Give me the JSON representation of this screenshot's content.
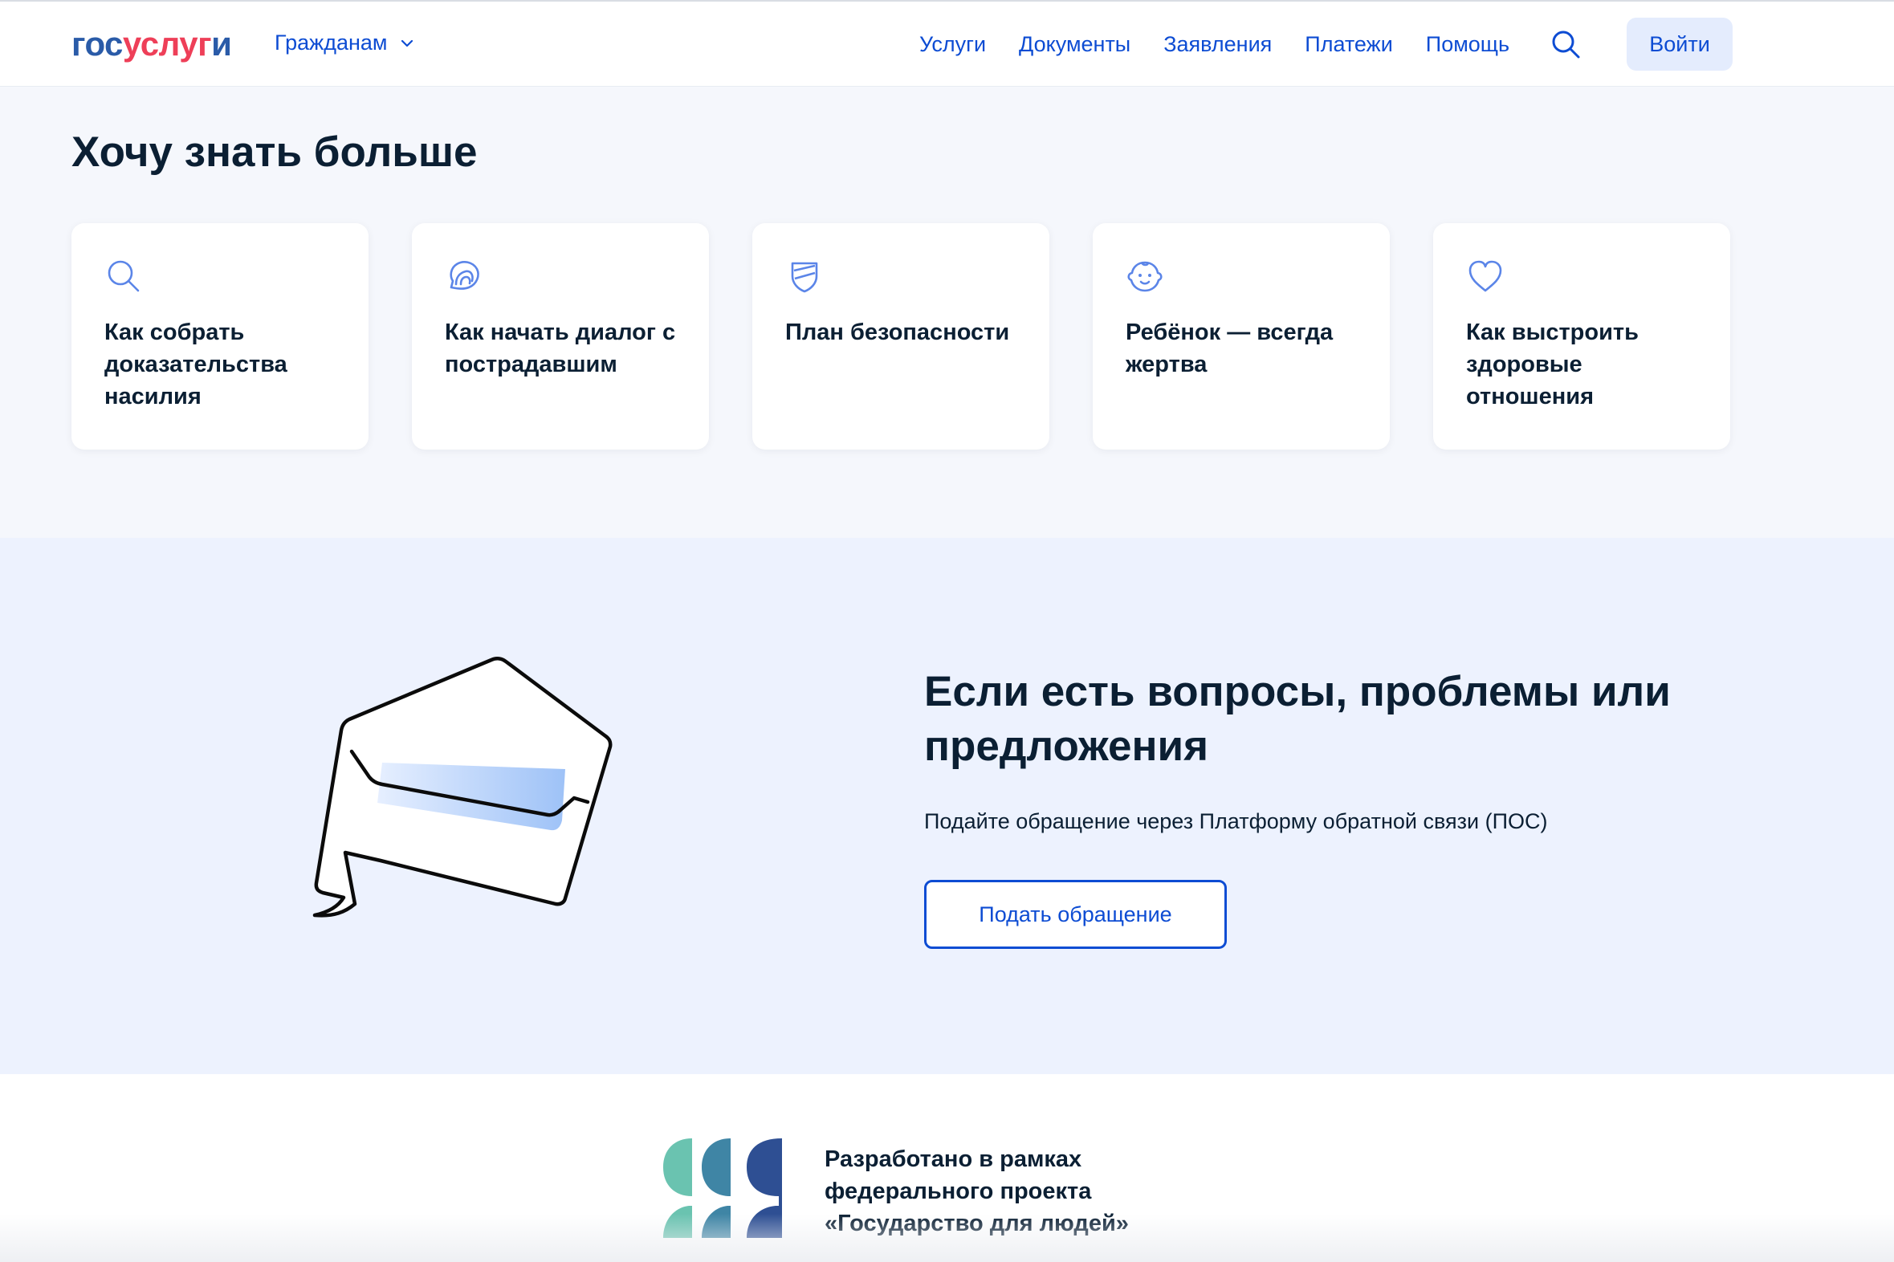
{
  "header": {
    "logo": {
      "part1": "гос",
      "part2": "услуг",
      "part3": "и"
    },
    "audience_label": "Гражданам",
    "nav": [
      "Услуги",
      "Документы",
      "Заявления",
      "Платежи",
      "Помощь"
    ],
    "login_label": "Войти"
  },
  "more": {
    "title": "Хочу знать больше",
    "cards": [
      {
        "icon": "search-icon",
        "text": "Как собрать доказательства насилия"
      },
      {
        "icon": "dialog-icon",
        "text": "Как начать диалог с пострадавшим"
      },
      {
        "icon": "shield-icon",
        "text": "План безопасности"
      },
      {
        "icon": "child-face-icon",
        "text": "Ребёнок — всегда жертва"
      },
      {
        "icon": "heart-icon",
        "text": "Как выстроить здоровые отношения"
      }
    ]
  },
  "feedback": {
    "title": "Если есть вопросы, проблемы или предложения",
    "subtitle": "Подайте обращение через Платформу обратной связи (ПОС)",
    "button_label": "Подать обращение"
  },
  "footer": {
    "project_lines": [
      "Разработано в рамках",
      "федерального проекта",
      "«Государство для людей»"
    ]
  },
  "colors": {
    "accent": "#0d4cd3",
    "logo_blue": "#2a5ba8",
    "logo_red": "#ee3f58",
    "section_bg": "#f5f7fc",
    "feedback_bg": "#edf2fe",
    "text": "#0b1f33"
  }
}
